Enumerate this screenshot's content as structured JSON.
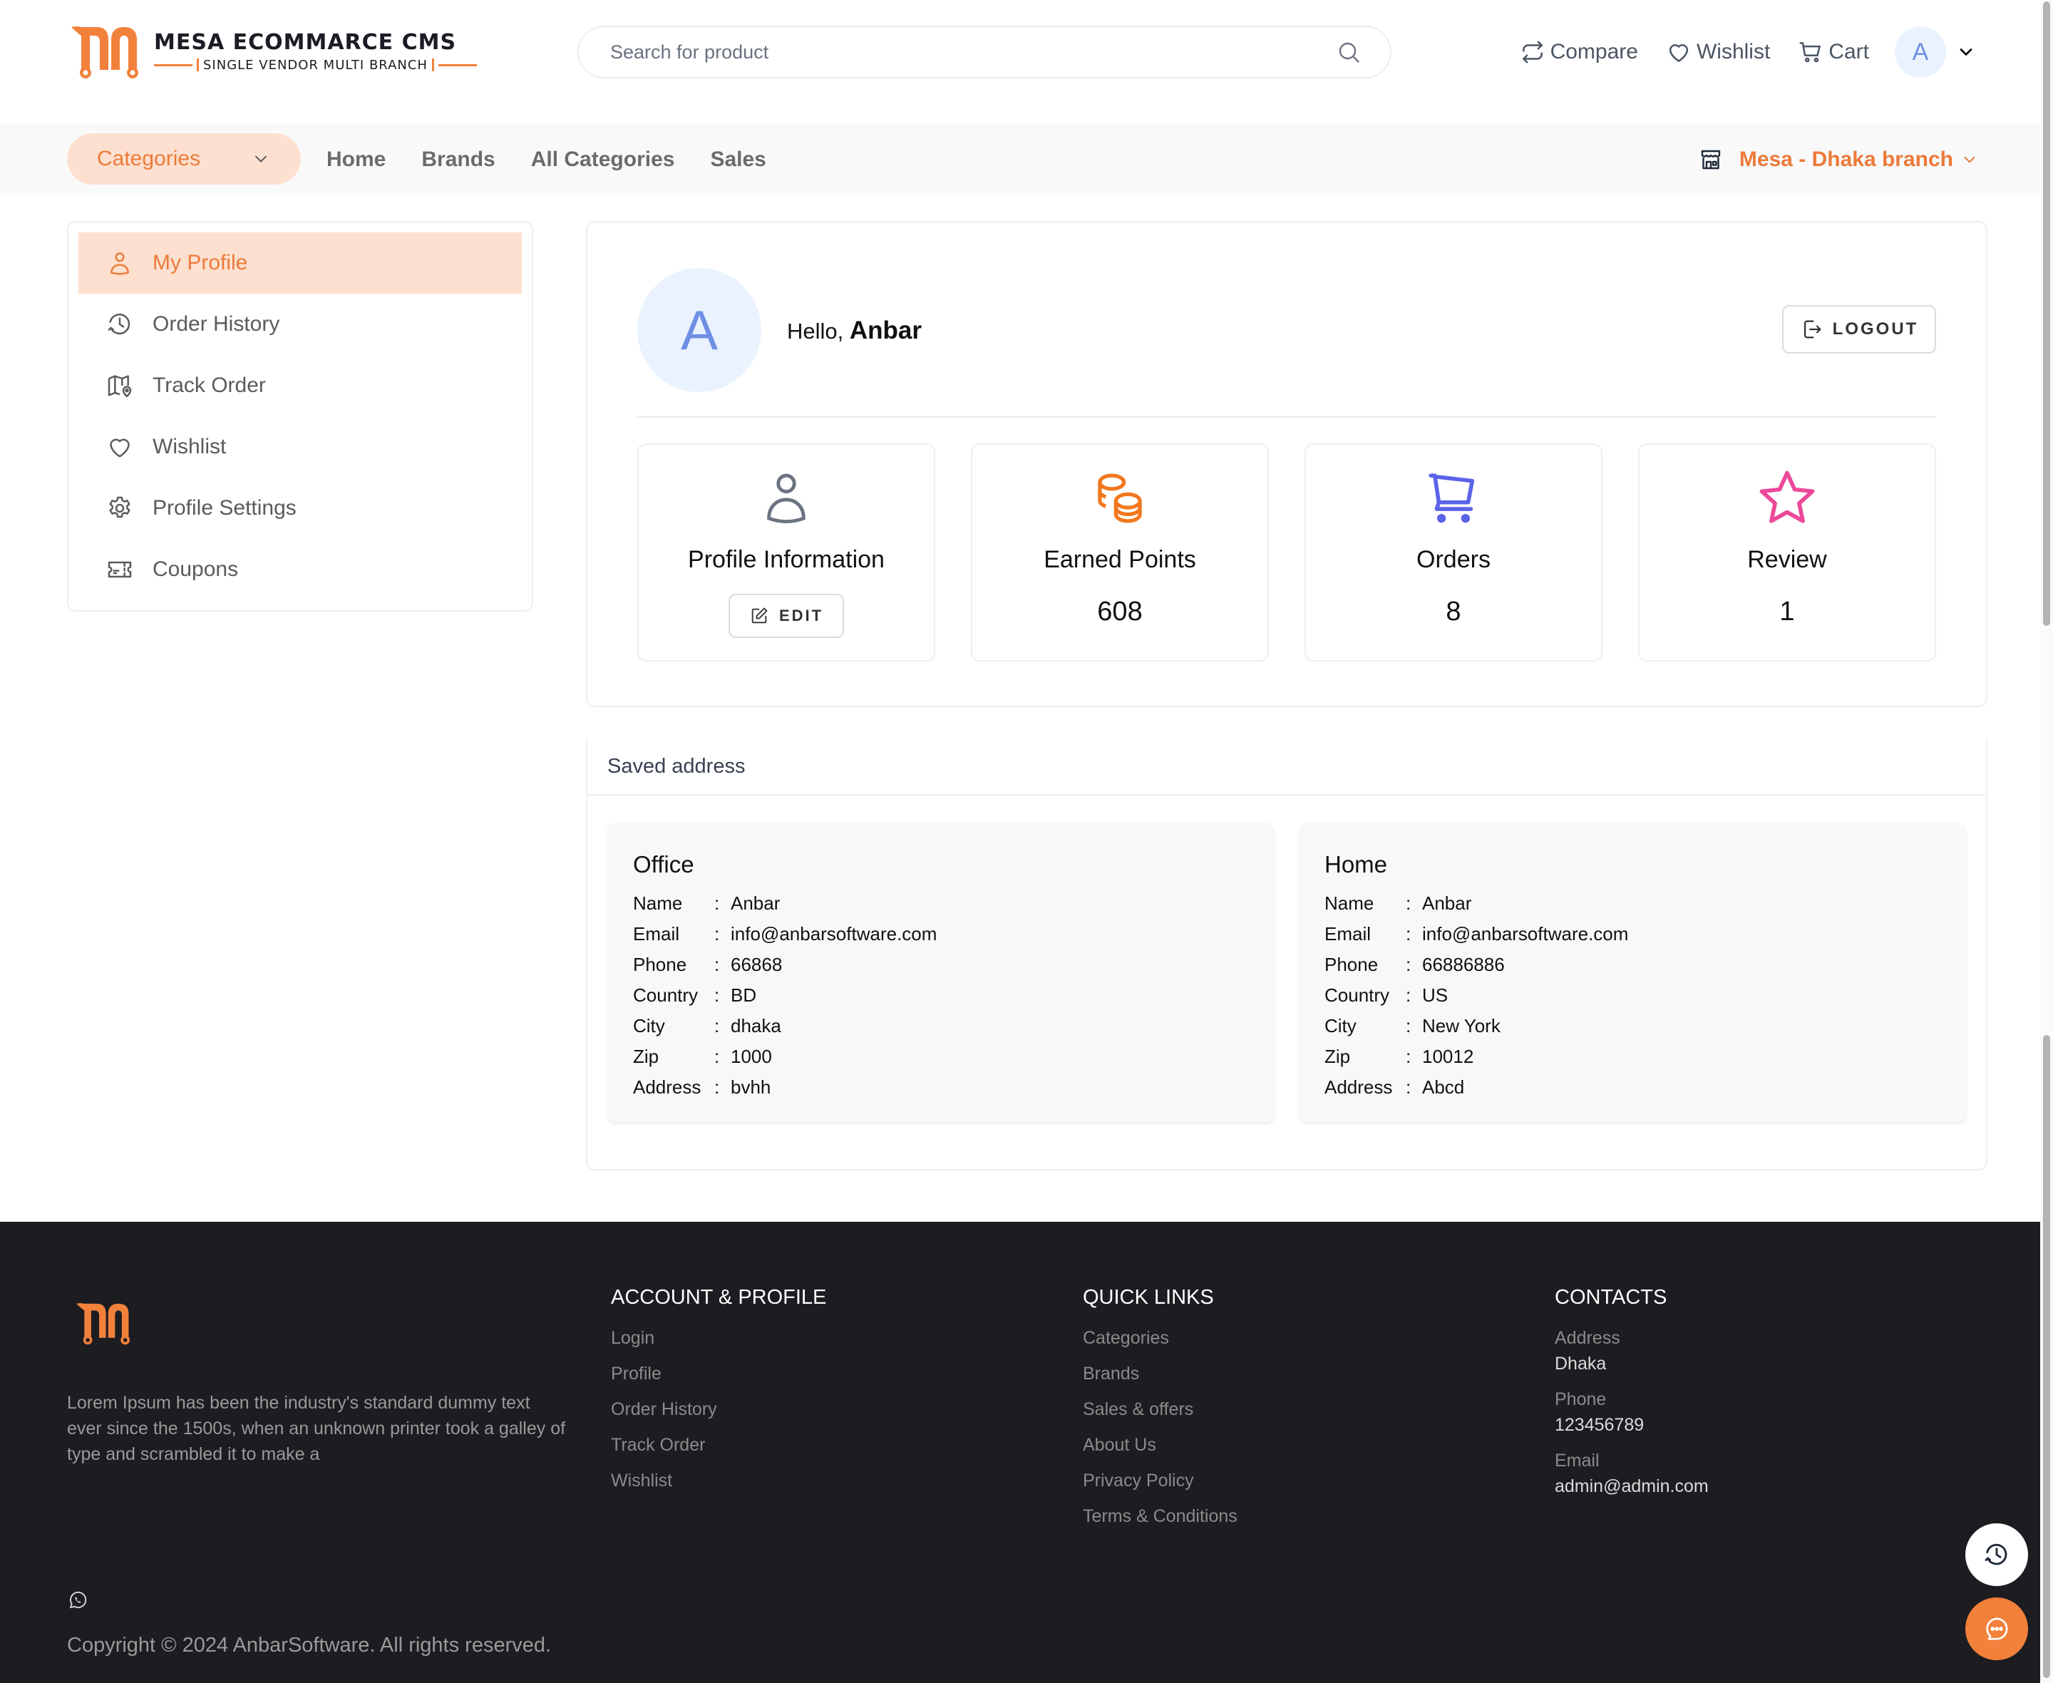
{
  "brand": {
    "title": "MESA ECOMMARCE CMS",
    "subtitle": "SINGLE VENDOR MULTI BRANCH",
    "accent": "#F2813B"
  },
  "header": {
    "search_placeholder": "Search for product",
    "actions": [
      {
        "icon": "compare-icon",
        "label": "Compare"
      },
      {
        "icon": "heart-icon",
        "label": "Wishlist"
      },
      {
        "icon": "cart-icon",
        "label": "Cart"
      }
    ],
    "user_initial": "A"
  },
  "nav": {
    "categories_label": "Categories",
    "links": [
      "Home",
      "Brands",
      "All Categories",
      "Sales"
    ],
    "branch": "Mesa - Dhaka branch"
  },
  "sidebar": {
    "items": [
      {
        "icon": "user-icon",
        "label": "My Profile",
        "active": true
      },
      {
        "icon": "history-icon",
        "label": "Order History"
      },
      {
        "icon": "map-pin-icon",
        "label": "Track Order"
      },
      {
        "icon": "heart-icon",
        "label": "Wishlist"
      },
      {
        "icon": "gear-icon",
        "label": "Profile Settings"
      },
      {
        "icon": "ticket-icon",
        "label": "Coupons"
      }
    ]
  },
  "profile": {
    "initial": "A",
    "greeting": "Hello,",
    "name": "Anbar",
    "logout_label": "LOGOUT",
    "stats": [
      {
        "icon": "user-icon",
        "label": "Profile Information",
        "button": "EDIT",
        "color": "#6B7280"
      },
      {
        "icon": "coins-icon",
        "label": "Earned Points",
        "value": "608",
        "color": "#F2781E"
      },
      {
        "icon": "cart-icon",
        "label": "Orders",
        "value": "8",
        "color": "#5B63E8"
      },
      {
        "icon": "star-icon",
        "label": "Review",
        "value": "1",
        "color": "#EC4899"
      }
    ]
  },
  "addresses": {
    "title": "Saved address",
    "items": [
      {
        "type": "Office",
        "fields": [
          {
            "k": "Name",
            "v": "Anbar"
          },
          {
            "k": "Email",
            "v": "info@anbarsoftware.com"
          },
          {
            "k": "Phone",
            "v": "66868"
          },
          {
            "k": "Country",
            "v": "BD"
          },
          {
            "k": "City",
            "v": "dhaka"
          },
          {
            "k": "Zip",
            "v": "1000"
          },
          {
            "k": "Address",
            "v": "bvhh"
          }
        ]
      },
      {
        "type": "Home",
        "fields": [
          {
            "k": "Name",
            "v": "Anbar"
          },
          {
            "k": "Email",
            "v": "info@anbarsoftware.com"
          },
          {
            "k": "Phone",
            "v": "66886886"
          },
          {
            "k": "Country",
            "v": "US"
          },
          {
            "k": "City",
            "v": "New York"
          },
          {
            "k": "Zip",
            "v": "10012"
          },
          {
            "k": "Address",
            "v": "Abcd"
          }
        ]
      }
    ]
  },
  "footer": {
    "description": "Lorem Ipsum has been the industry's standard dummy text ever since the 1500s, when an unknown printer took a galley of type and scrambled it to make a",
    "account": {
      "title": "ACCOUNT & PROFILE",
      "links": [
        "Login",
        "Profile",
        "Order History",
        "Track Order",
        "Wishlist"
      ]
    },
    "quick": {
      "title": "QUICK LINKS",
      "links": [
        "Categories",
        "Brands",
        "Sales & offers",
        "About Us",
        "Privacy Policy",
        "Terms & Conditions"
      ]
    },
    "contacts": {
      "title": "CONTACTS",
      "items": [
        {
          "label": "Address",
          "value": "Dhaka"
        },
        {
          "label": "Phone",
          "value": "123456789"
        },
        {
          "label": "Email",
          "value": "admin@admin.com"
        }
      ]
    },
    "copyright": "Copyright © 2024 AnbarSoftware. All rights reserved."
  }
}
